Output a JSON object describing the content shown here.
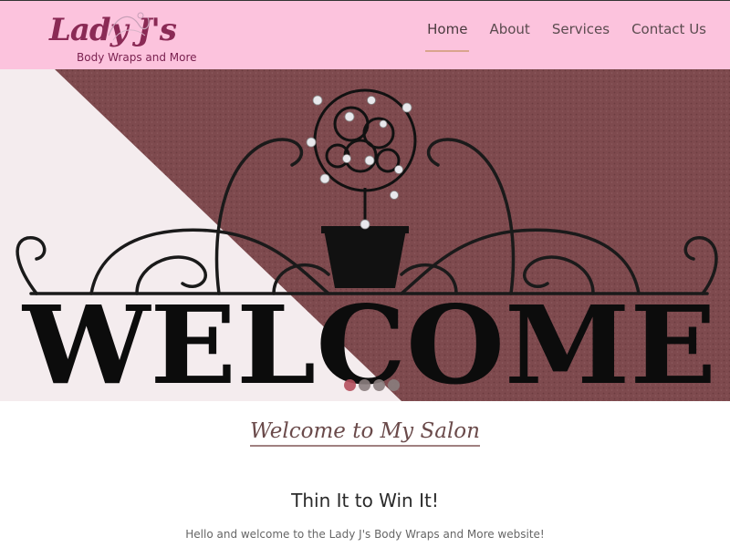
{
  "header": {
    "logo_title": "Lady J's",
    "logo_subtitle": "Body Wraps and More",
    "nav": [
      {
        "label": "Home",
        "active": true
      },
      {
        "label": "About",
        "active": false
      },
      {
        "label": "Services",
        "active": false
      },
      {
        "label": "Contact Us",
        "active": false
      }
    ]
  },
  "hero": {
    "sign_text": "WELCOME",
    "slider_dots": 4,
    "active_slide": 1
  },
  "content": {
    "tagline": "Welcome to My Salon",
    "heading": "Thin It to Win It!",
    "intro": "Hello and welcome to the Lady J's Body Wraps and More website!"
  },
  "colors": {
    "header_bg": "#fcc3dd",
    "wall_mauve": "#7e4a4e",
    "wall_white": "#f4ecee",
    "logo": "#8a2a55",
    "nav_underline": "#d9a48d"
  }
}
